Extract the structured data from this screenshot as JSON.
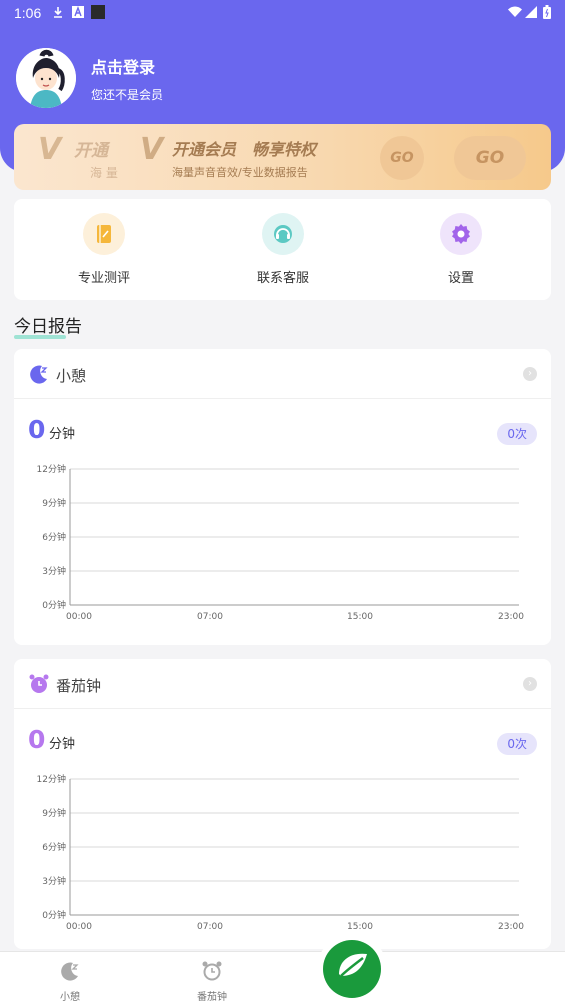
{
  "status": {
    "time": "1:06"
  },
  "profile": {
    "login": "点击登录",
    "member_status": "您还不是会员"
  },
  "banner": {
    "ghost_title": "开通",
    "ghost_sub": "海 量",
    "title": "开通会员　畅享特权",
    "subtitle": "海量声音音效/专业数据报告",
    "go_small": "GO",
    "go_large": "GO"
  },
  "quick_actions": [
    {
      "label": "专业测评"
    },
    {
      "label": "联系客服"
    },
    {
      "label": "设置"
    }
  ],
  "today": {
    "title": "今日报告"
  },
  "cards": [
    {
      "title": "小憩",
      "value": "0",
      "unit": "分钟",
      "count": "0次",
      "accent": "#6a67ee",
      "chart_data": {
        "type": "line",
        "x": [
          "00:00",
          "07:00",
          "15:00",
          "23:00"
        ],
        "yticks": [
          "0分钟",
          "3分钟",
          "6分钟",
          "9分钟",
          "12分钟"
        ],
        "ylim": [
          0,
          12
        ],
        "series": []
      }
    },
    {
      "title": "番茄钟",
      "value": "0",
      "unit": "分钟",
      "count": "0次",
      "accent": "#b678ee",
      "chart_data": {
        "type": "line",
        "x": [
          "00:00",
          "07:00",
          "15:00",
          "23:00"
        ],
        "yticks": [
          "0分钟",
          "3分钟",
          "6分钟",
          "9分钟",
          "12分钟"
        ],
        "ylim": [
          0,
          12
        ],
        "series": []
      }
    }
  ],
  "nav": [
    {
      "label": "小憩",
      "icon": "moon-icon"
    },
    {
      "label": "番茄钟",
      "icon": "alarm-clock-icon"
    }
  ]
}
